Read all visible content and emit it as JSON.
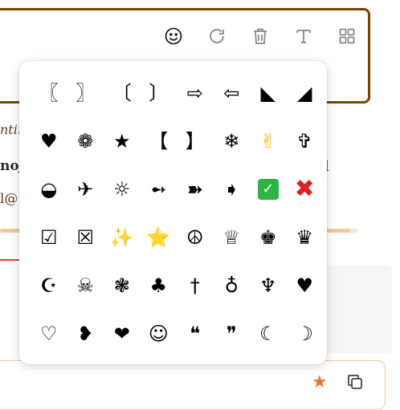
{
  "toolbar": {
    "emoji_icon": "smiley-icon",
    "refresh_icon": "refresh-icon",
    "delete_icon": "trash-icon",
    "text_icon": "text-format-icon",
    "grid_icon": "grid-icon"
  },
  "background": {
    "line1": "ntiı",
    "line2": "noj",
    "line3": "l@",
    "right_fragment": "l"
  },
  "slider": {
    "value_fraction": 0.98
  },
  "symbols": [
    [
      "〖",
      "〗",
      "〔",
      "〕",
      "⇨",
      "⇦",
      "◣",
      "◢"
    ],
    [
      "♥",
      "❁",
      "★",
      "【",
      "】",
      "❄",
      "✌",
      "✞"
    ],
    [
      "◒",
      "✈",
      "☼",
      "➻",
      "➽",
      "➧",
      "✓",
      "✖"
    ],
    [
      "☑",
      "☒",
      "✨",
      "⭐",
      "☮",
      "♕",
      "♚",
      "♛"
    ],
    [
      "☪",
      "☠",
      "❃",
      "♣",
      "†",
      "♁",
      "♆",
      "♥"
    ],
    [
      "♡",
      "❥",
      "❤",
      "☺",
      "❝",
      "❞",
      "☾",
      "☽"
    ]
  ],
  "colors": {
    "frame_border": "#7a4300",
    "accent": "#e8752e",
    "check_green": "#2fb344",
    "cross_red": "#e0201b"
  },
  "bottom": {
    "star_icon": "star-icon",
    "copy_icon": "copy-icon"
  }
}
